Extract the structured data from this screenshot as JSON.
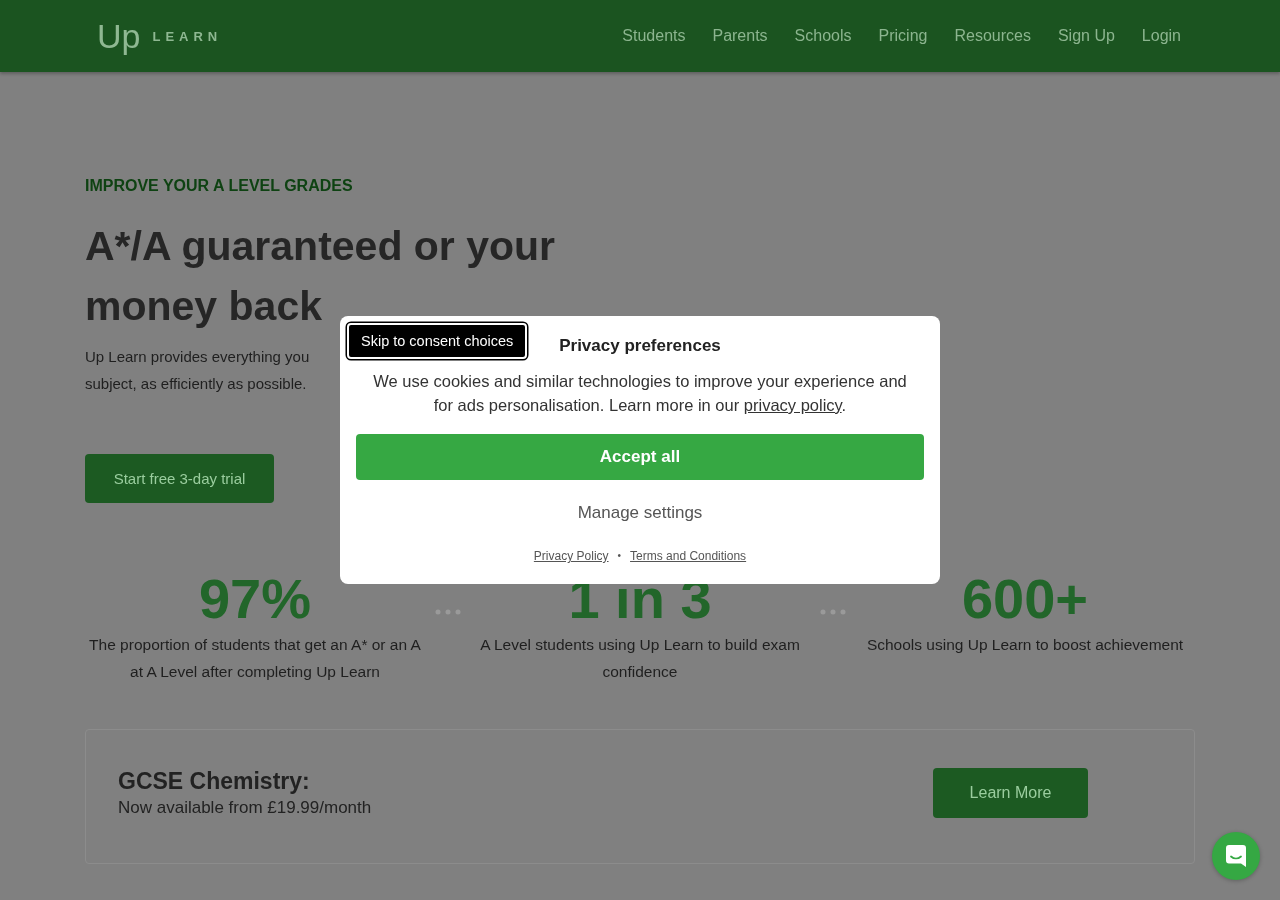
{
  "header": {
    "logo": {
      "mark": "Up",
      "word": "LEARN"
    },
    "nav": [
      {
        "label": "Students"
      },
      {
        "label": "Parents"
      },
      {
        "label": "Schools"
      },
      {
        "label": "Pricing"
      },
      {
        "label": "Resources"
      },
      {
        "label": "Sign Up"
      },
      {
        "label": "Login"
      }
    ]
  },
  "hero": {
    "eyebrow": "IMPROVE YOUR A LEVEL GRADES",
    "title": "A*/A guaranteed or your money back",
    "description_lines": [
      "Up Learn provides everything you",
      "subject, as efficiently as possible."
    ],
    "cta": "Start free 3-day trial"
  },
  "stats": [
    {
      "value": "97%",
      "caption": "The proportion of students that get an A* or an A at A Level after completing Up Learn"
    },
    {
      "value": "1 in 3",
      "caption": "A Level students using Up Learn to build exam confidence"
    },
    {
      "value": "600+",
      "caption": "Schools using Up Learn to boost achievement"
    }
  ],
  "promo": {
    "title": "GCSE Chemistry:",
    "subtitle": "Now available from £19.99/month",
    "button": "Learn More"
  },
  "consent_dialog": {
    "skip_link": "Skip to consent choices",
    "title": "Privacy preferences",
    "message": "We use cookies and similar technologies to improve your experience and for ads personalisation. Learn more in our",
    "message_link": "privacy policy",
    "message_end": ".",
    "accept_button": "Accept all",
    "manage_button": "Manage settings",
    "footer_links": [
      "Privacy Policy",
      "Terms and Conditions"
    ],
    "footer_separator": "•"
  }
}
